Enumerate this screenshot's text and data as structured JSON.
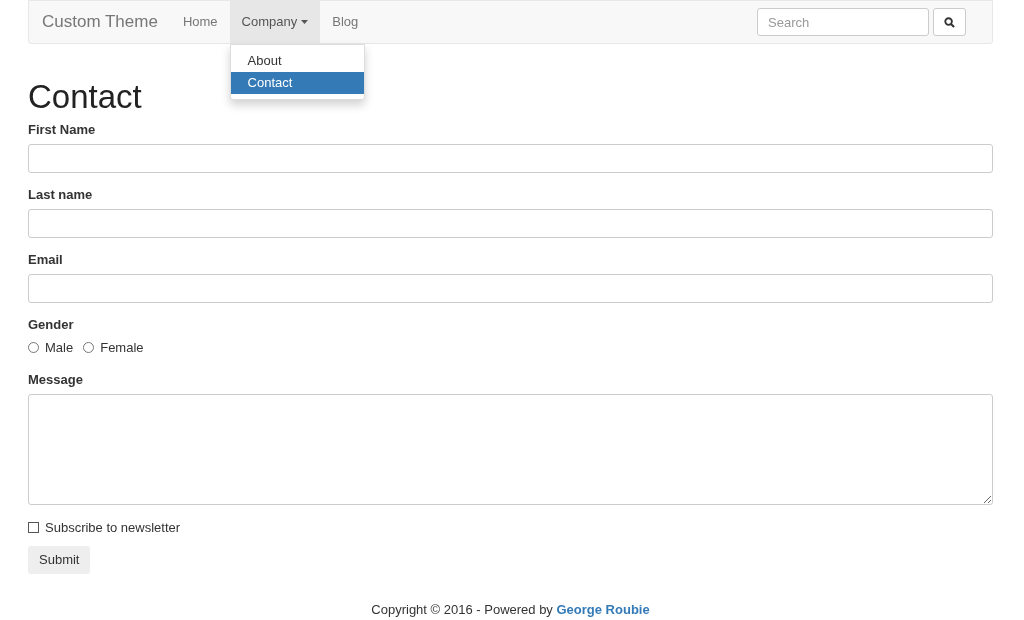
{
  "navbar": {
    "brand": "Custom Theme",
    "items": [
      {
        "label": "Home",
        "kind": "link",
        "expanded": false
      },
      {
        "label": "Company",
        "kind": "dropdown",
        "expanded": true,
        "menu": [
          {
            "label": "About",
            "selected": false
          },
          {
            "label": "Contact",
            "selected": true
          }
        ]
      },
      {
        "label": "Blog",
        "kind": "link",
        "expanded": false
      }
    ],
    "search": {
      "placeholder": "Search"
    }
  },
  "heading": "Contact",
  "form": {
    "fields": [
      {
        "label": "First Name",
        "kind": "text"
      },
      {
        "label": "Last name",
        "kind": "text"
      },
      {
        "label": "Email",
        "kind": "text"
      },
      {
        "label": "Gender",
        "kind": "radio",
        "options": [
          {
            "label": "Male",
            "selected": false
          },
          {
            "label": "Female",
            "selected": false
          }
        ]
      },
      {
        "label": "Message",
        "kind": "textarea"
      }
    ],
    "newsletter": {
      "label": "Subscribe to newsletter",
      "checked": false
    },
    "submit": "Submit"
  },
  "footer": {
    "text": "Copyright © 2016 - Powered by ",
    "link": "George Roubie"
  }
}
